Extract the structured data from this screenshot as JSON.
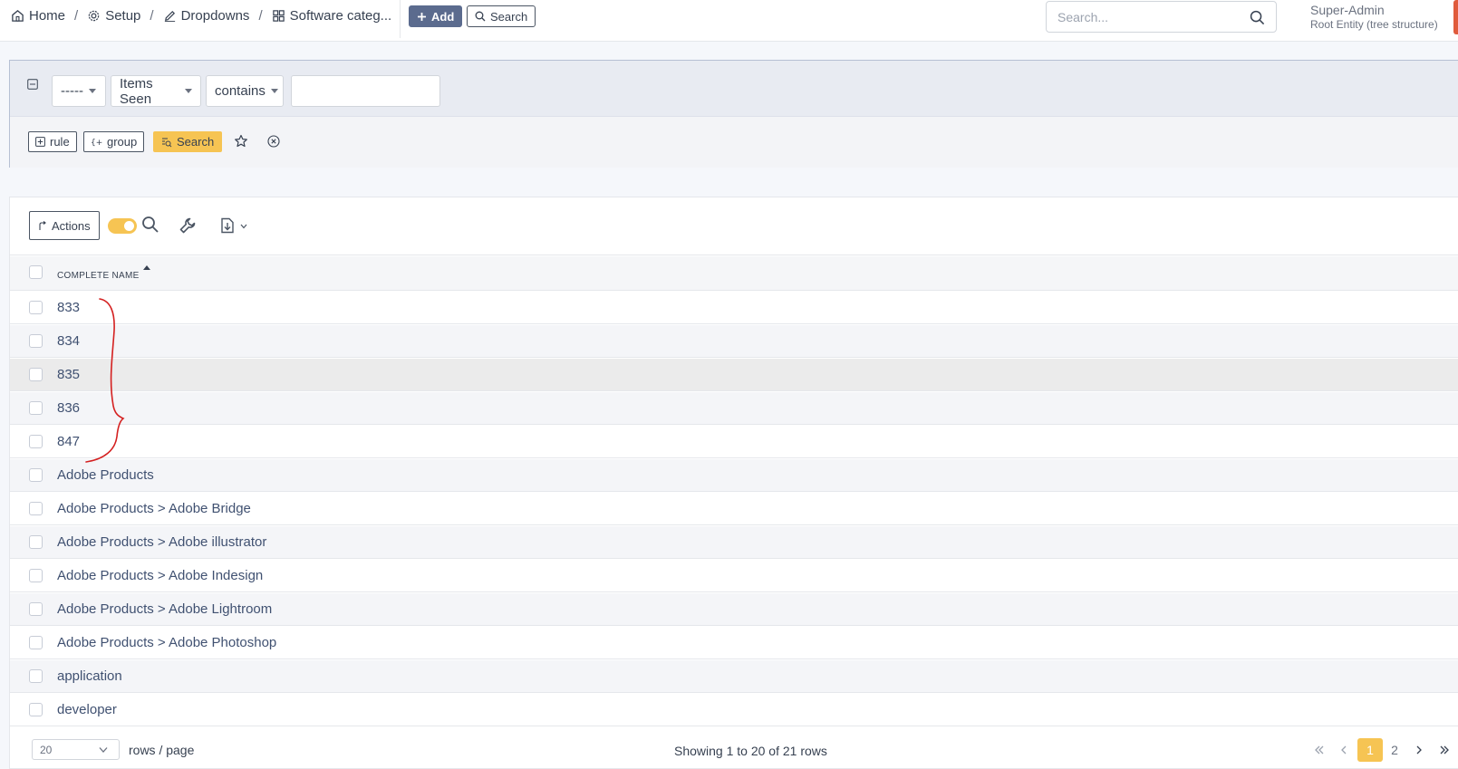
{
  "breadcrumb": {
    "home": "Home",
    "setup": "Setup",
    "dropdowns": "Dropdowns",
    "current": "Software categ...",
    "separator": "/"
  },
  "topbar": {
    "add_label": "Add",
    "search_label": "Search",
    "global_search_placeholder": "Search...",
    "user_name": "Super-Admin",
    "user_entity": "Root Entity (tree structure)"
  },
  "filter": {
    "link_value": "-----",
    "field_value": "Items Seen",
    "operator_value": "contains",
    "value": "",
    "rule_label": "rule",
    "group_label": "group",
    "search_label": "Search"
  },
  "toolbar": {
    "actions_label": "Actions"
  },
  "table": {
    "column_header": "COMPLETE NAME",
    "rows": [
      "833",
      "834",
      "835",
      "836",
      "847",
      "Adobe Products",
      "Adobe Products > Adobe Bridge",
      "Adobe Products > Adobe illustrator",
      "Adobe Products > Adobe Indesign",
      "Adobe Products > Adobe Lightroom",
      "Adobe Products > Adobe Photoshop",
      "application",
      "developer"
    ]
  },
  "pagination": {
    "rows_per_page_value": "20",
    "rows_per_page_label": "rows / page",
    "showing_text": "Showing 1 to 20 of 21 rows",
    "pages": [
      "1",
      "2"
    ],
    "active_page": "1"
  },
  "colors": {
    "accent": "#f6c453",
    "primary_button": "#5b6b8e",
    "link_text": "#405171",
    "annotation_red": "#d42020"
  },
  "icons": [
    "home-icon",
    "gear-icon",
    "edit-icon",
    "grid-icon",
    "plus-icon",
    "search-icon",
    "collapse-icon",
    "star-icon",
    "clear-icon",
    "wrench-icon",
    "export-icon"
  ]
}
